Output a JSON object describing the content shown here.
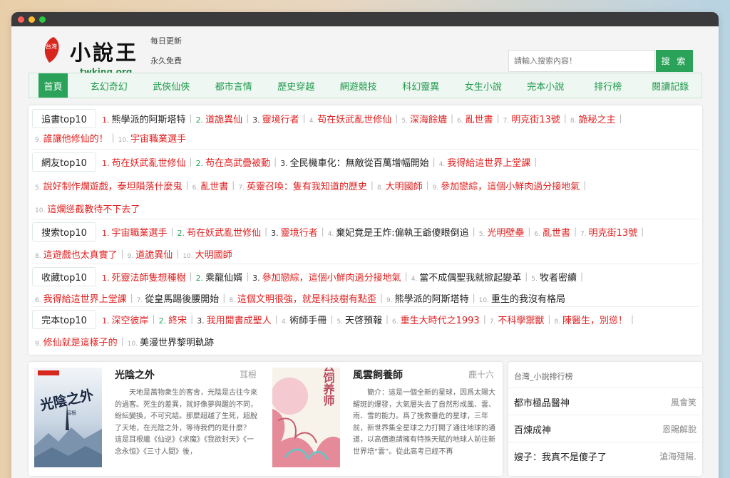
{
  "site": {
    "logo_badge": "台灣",
    "logo_title": "小說王",
    "logo_domain": "twking.org",
    "slogan_1": "每日更新",
    "slogan_2": "永久免費"
  },
  "search": {
    "placeholder": "請輸入搜索內容！",
    "button_label": "搜 索"
  },
  "nav": {
    "items": [
      "首頁",
      "玄幻奇幻",
      "武俠仙俠",
      "都市言情",
      "歷史穿越",
      "網遊競技",
      "科幻靈異",
      "女生小說",
      "完本小說",
      "排行榜",
      "閱讀記錄"
    ],
    "active_index": 0
  },
  "rankings": [
    {
      "label": "追書top10",
      "entries": [
        {
          "n": "1.",
          "t": "熊學派的阿斯塔特"
        },
        {
          "n": "2.",
          "t": "道詭異仙"
        },
        {
          "n": "3.",
          "t": "靈境行者"
        },
        {
          "n": "4.",
          "t": "苟在妖武亂世修仙"
        },
        {
          "n": "5.",
          "t": "深海餘燼"
        },
        {
          "n": "6.",
          "t": "亂世書"
        },
        {
          "n": "7.",
          "t": "明克街13號"
        },
        {
          "n": "8.",
          "t": "詭秘之主"
        },
        {
          "n": "9.",
          "t": "誰讓他修仙的！"
        },
        {
          "n": "10.",
          "t": "宇宙職業選手"
        }
      ]
    },
    {
      "label": "網友top10",
      "entries": [
        {
          "n": "1.",
          "t": "苟在妖武亂世修仙"
        },
        {
          "n": "2.",
          "t": "苟在高武疊被動"
        },
        {
          "n": "3.",
          "t": "全民機車化：無敵從百萬增幅開始"
        },
        {
          "n": "4.",
          "t": "我得給這世界上堂課"
        },
        {
          "n": "5.",
          "t": "說好制作爛遊戲，泰坦隕落什麼鬼"
        },
        {
          "n": "6.",
          "t": "亂世書"
        },
        {
          "n": "7.",
          "t": "英靈召喚：隻有我知道的歷史"
        },
        {
          "n": "8.",
          "t": "大明國師"
        },
        {
          "n": "9.",
          "t": "參加戀綜，這個小鮮肉過分接地氣"
        },
        {
          "n": "10.",
          "t": "這爛慫截教待不下去了"
        }
      ]
    },
    {
      "label": "搜索top10",
      "entries": [
        {
          "n": "1.",
          "t": "宇宙職業選手"
        },
        {
          "n": "2.",
          "t": "苟在妖武亂世修仙"
        },
        {
          "n": "3.",
          "t": "靈境行者"
        },
        {
          "n": "4.",
          "t": "棄妃竟是王炸:偏執王爺傻眼倒追"
        },
        {
          "n": "5.",
          "t": "光明壁壘"
        },
        {
          "n": "6.",
          "t": "亂世書"
        },
        {
          "n": "7.",
          "t": "明克街13號"
        },
        {
          "n": "8.",
          "t": "這遊戲也太真實了"
        },
        {
          "n": "9.",
          "t": "道詭異仙"
        },
        {
          "n": "10.",
          "t": "大明國師"
        }
      ]
    },
    {
      "label": "收藏top10",
      "entries": [
        {
          "n": "1.",
          "t": "死靈法師隻想種樹"
        },
        {
          "n": "2.",
          "t": "乘龍仙婿"
        },
        {
          "n": "3.",
          "t": "參加戀綜，這個小鮮肉過分接地氣"
        },
        {
          "n": "4.",
          "t": "當不成偶聖我就掀起變革"
        },
        {
          "n": "5.",
          "t": "牧者密續"
        },
        {
          "n": "6.",
          "t": "我得給這世界上堂課"
        },
        {
          "n": "7.",
          "t": "從皇馬踢後腰開始"
        },
        {
          "n": "8.",
          "t": "這個文明很強，就是科技樹有點歪"
        },
        {
          "n": "9.",
          "t": "熊學派的阿斯塔特"
        },
        {
          "n": "10.",
          "t": "重生的我沒有格局"
        }
      ]
    },
    {
      "label": "完本top10",
      "entries": [
        {
          "n": "1.",
          "t": "深空彼岸"
        },
        {
          "n": "2.",
          "t": "終宋"
        },
        {
          "n": "3.",
          "t": "我用閒書成聖人"
        },
        {
          "n": "4.",
          "t": "術師手冊"
        },
        {
          "n": "5.",
          "t": "天啓預報"
        },
        {
          "n": "6.",
          "t": "重生大時代之1993"
        },
        {
          "n": "7.",
          "t": "不科學禦獸"
        },
        {
          "n": "8.",
          "t": "陳醫生，別慫！"
        },
        {
          "n": "9.",
          "t": "修仙就是這樣子的"
        },
        {
          "n": "10.",
          "t": "美漫世界黎明軌跡"
        }
      ]
    }
  ],
  "featured_books": [
    {
      "cover_title": "光陰之外",
      "cover_author": "耳根",
      "title": "光陰之外",
      "author": "耳根",
      "description": "天地是萬物衆生的客舍，光陰是古往今來的過客。死生的差異，就好像夢與醒的不同，紛紜變換，不可究詰。那麼超越了生死，超脫了天地，在光陰之外，等待我們的是什麼？ 這是耳根繼《仙逆》《求魔》《我欲封天》《一念永恒》《三寸人間》後，"
    },
    {
      "cover_title": "风云饲养师",
      "cover_author": "鹿十六",
      "title": "風雲飼養師",
      "author": "鹿十六",
      "description": "簡介：這是一個全新的星球，因爲太陽大耀斑的爆發，大氣層失去了自然形成風、雲、雨、雪的能力。爲了挽救垂危的星球，三年前，新世界集全星球之力打開了通往地球的通道，以高價邀請擁有特殊天賦的地球人前往新世界培“雲”。從此高考已經不再"
    }
  ],
  "sidebar": {
    "title": "台灣_小說排行榜",
    "items": [
      {
        "name": "都市極品醫神",
        "author": "風會笑"
      },
      {
        "name": "百煉成神",
        "author": "恩賜解脫"
      },
      {
        "name": "嫂子：我真不是傻子了",
        "author": "滄海殘陽."
      }
    ]
  },
  "colors": {
    "accent_green": "#2aa25a",
    "link_red": "#e02020",
    "window_bar": "#3a3a3c",
    "dot_red": "#fe5f57",
    "dot_yellow": "#febc2e",
    "dot_green": "#28c840"
  }
}
